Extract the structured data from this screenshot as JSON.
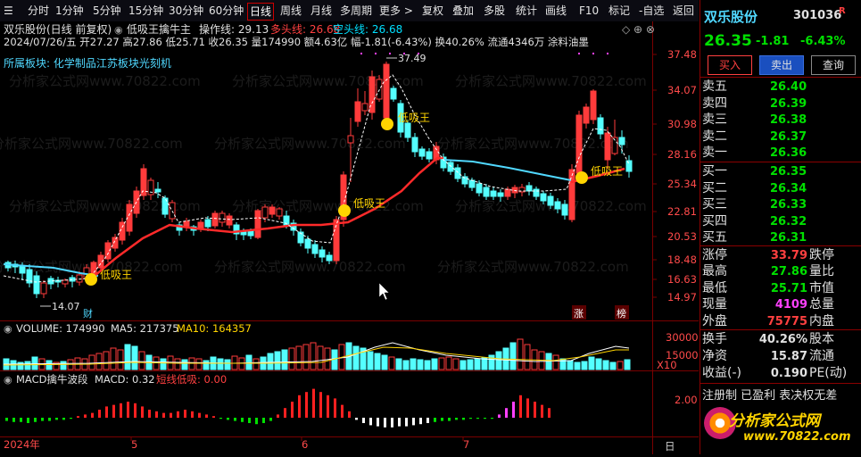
{
  "toolbar": {
    "items": [
      "分时",
      "1分钟",
      "5分钟",
      "15分钟",
      "30分钟",
      "60分钟",
      "日线",
      "周线",
      "月线",
      "多周期",
      "更多 >",
      "复权",
      "叠加",
      "多股",
      "统计",
      "画线",
      "F10",
      "标记",
      "-自选",
      "返回"
    ],
    "active": "日线",
    "menu_glyph": "☰"
  },
  "header": {
    "stock_line": "双乐股份(日线 前复权)",
    "indicator_name": "低吸王擒牛主",
    "op_label": "操作线: 29.13",
    "bull_label": "多头线: 26.68",
    "bear_label": "空头线: 26.68",
    "info_line": "2024/07/26/五 开27.27 高27.86 低25.71 收26.35 量174990 额4.63亿 幅-1.81(-6.43%) 换40.26% 流通4346万 涂料油墨",
    "sector_line": "所属板块: 化学制品江苏板块光刻机"
  },
  "watermark": "分析家公式网www.70822.com",
  "price_axis": [
    "37.48",
    "34.07",
    "30.98",
    "28.16",
    "25.34",
    "22.81",
    "20.53",
    "18.48",
    "16.63",
    "14.97"
  ],
  "annotations": {
    "high": "37.49",
    "low": "14.07",
    "signal": "低吸王",
    "markers": [
      "财",
      "涨",
      "榜"
    ]
  },
  "volume": {
    "label": "VOLUME: 174990",
    "ma5": "MA5: 217375",
    "ma10": "MA10: 164357",
    "axis": [
      "30000",
      "15000"
    ],
    "unit": "X10"
  },
  "macd": {
    "label": "MACD擒牛波段",
    "value": "MACD: 0.32",
    "short": "短线低吸: 0.00",
    "axis": "2.00"
  },
  "time_axis": [
    "2024年",
    "5",
    "6",
    "7",
    "日"
  ],
  "quote": {
    "name": "双乐股份",
    "code": "301036",
    "flag": "R",
    "price": "26.35",
    "change": "-1.81",
    "pct": "-6.43%",
    "buttons": [
      "买入",
      "卖出",
      "查询"
    ],
    "sells": [
      {
        "label": "卖五",
        "price": "26.40",
        "vol": ""
      },
      {
        "label": "卖四",
        "price": "26.39",
        "vol": ""
      },
      {
        "label": "卖三",
        "price": "26.38",
        "vol": ""
      },
      {
        "label": "卖二",
        "price": "26.37",
        "vol": ""
      },
      {
        "label": "卖一",
        "price": "26.36",
        "vol": ""
      }
    ],
    "buys": [
      {
        "label": "买一",
        "price": "26.35",
        "vol": ""
      },
      {
        "label": "买二",
        "price": "26.34",
        "vol": ""
      },
      {
        "label": "买三",
        "price": "26.33",
        "vol": ""
      },
      {
        "label": "买四",
        "price": "26.32",
        "vol": ""
      },
      {
        "label": "买五",
        "price": "26.31",
        "vol": ""
      }
    ],
    "stats": [
      {
        "l1": "涨停",
        "v1": "33.79",
        "l2": "跌停",
        "c": "#ff4040"
      },
      {
        "l1": "最高",
        "v1": "27.86",
        "l2": "量比",
        "c": "#00e000"
      },
      {
        "l1": "最低",
        "v1": "25.71",
        "l2": "市值",
        "c": "#00e000"
      },
      {
        "l1": "现量",
        "v1": "4109",
        "l2": "总量",
        "c": "#ff40ff"
      },
      {
        "l1": "外盘",
        "v1": "75775",
        "l2": "内盘",
        "c": "#ff4040"
      }
    ],
    "stats2": [
      {
        "l1": "换手",
        "v1": "40.26%",
        "l2": "股本"
      },
      {
        "l1": "净资",
        "v1": "15.87",
        "l2": "流通"
      },
      {
        "l1": "收益(-)",
        "v1": "0.190",
        "l2": "PE(动)"
      }
    ],
    "notice": "注册制 已盈利 表决权无差",
    "brand": "分析家公式网",
    "brand_url": "www.70822.com"
  },
  "colors": {
    "up": "#ff3b3b",
    "down": "#54ffff",
    "ma_red": "#ff2a2a",
    "ma_cyan": "#50d8ff",
    "bull": "#ff4040",
    "bear": "#00e0ff"
  }
}
